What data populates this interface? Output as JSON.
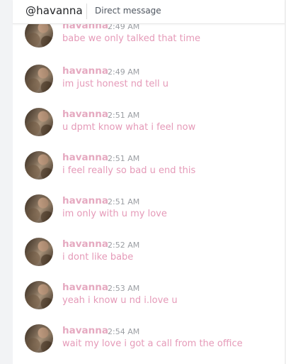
{
  "header": {
    "username": "@havanna",
    "subtitle": "Direct message"
  },
  "colors": {
    "author": "#e5a9c0",
    "message_text": "#e59ab8",
    "timestamp": "#9b9ea3",
    "header_text": "#202225",
    "sidebar": "#f2f3f5"
  },
  "messages": [
    {
      "author": "havanna",
      "time": "2:49 AM",
      "text": "babe we only talked that time"
    },
    {
      "author": "havanna",
      "time": "2:49 AM",
      "text": "im just honest nd tell u"
    },
    {
      "author": "havanna",
      "time": "2:51 AM",
      "text": "u dpmt know what i feel now"
    },
    {
      "author": "havanna",
      "time": "2:51 AM",
      "text": "i feel really so bad u end this"
    },
    {
      "author": "havanna",
      "time": "2:51 AM",
      "text": "im only with u my love"
    },
    {
      "author": "havanna",
      "time": "2:52 AM",
      "text": "i dont like babe"
    },
    {
      "author": "havanna",
      "time": "2:53 AM",
      "text": "yeah i know u nd i.love u"
    },
    {
      "author": "havanna",
      "time": "2:54 AM",
      "text": "wait my love i got a call from the office"
    }
  ]
}
